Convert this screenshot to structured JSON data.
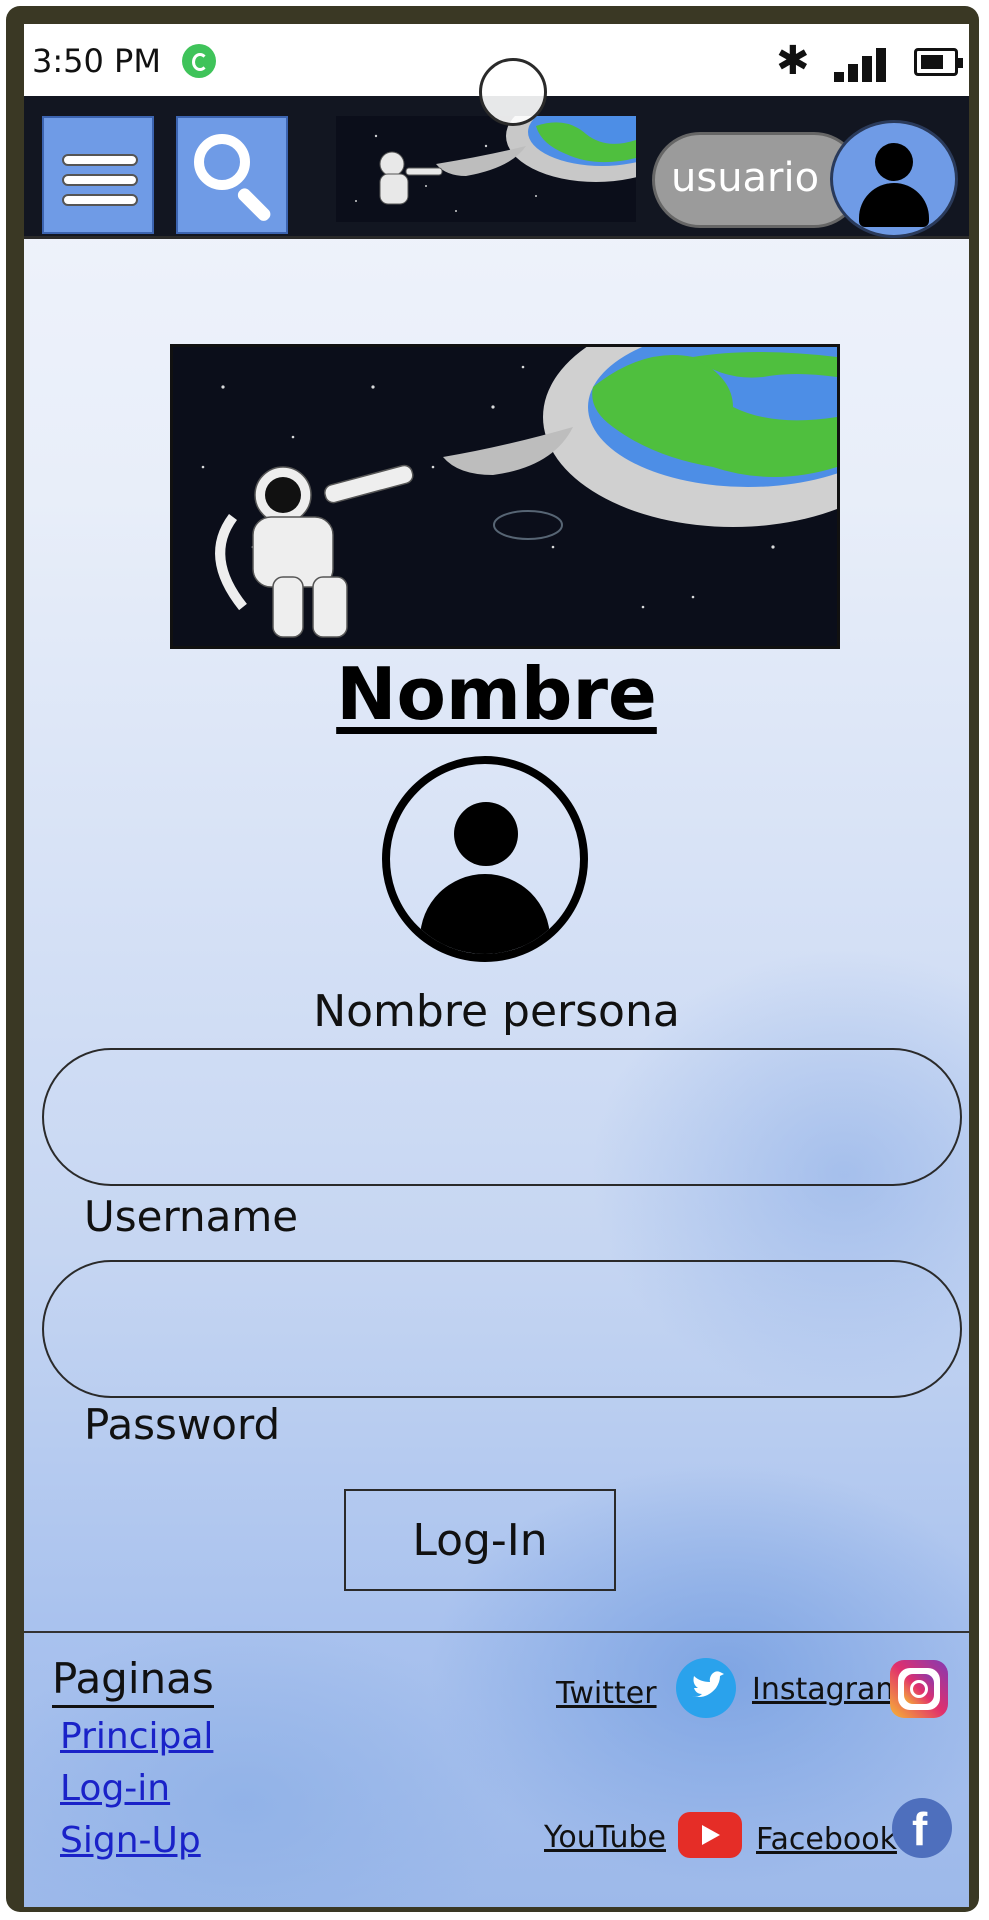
{
  "status_bar": {
    "time": "3:50 PM"
  },
  "header": {
    "user_label": "usuario"
  },
  "main": {
    "title": "Nombre",
    "person_name": "Nombre persona",
    "username_label": "Username",
    "password_label": "Password",
    "login_label": "Log-In"
  },
  "footer": {
    "pages_heading": "Paginas",
    "links": [
      "Principal",
      "Log-in",
      "Sign-Up"
    ],
    "social": {
      "twitter": "Twitter",
      "instagram": "Instagram",
      "youtube": "YouTube",
      "facebook": "Facebook"
    }
  },
  "colors": {
    "nav_bg": "#121621",
    "accent_blue": "#6f9be6",
    "link_blue": "#1a22c8"
  }
}
